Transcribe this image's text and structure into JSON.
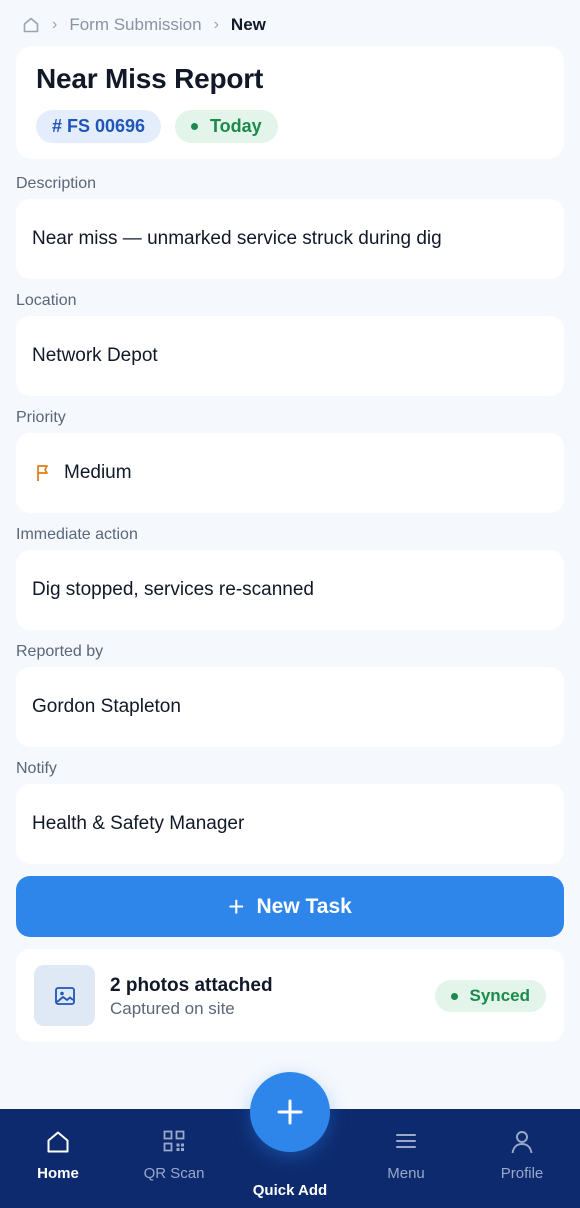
{
  "breadcrumb": {
    "home_icon": "home-icon",
    "parent": "Form Submission",
    "current": "New"
  },
  "header": {
    "title": "Near Miss Report",
    "id_badge": "# FS 00696",
    "date_badge": "Today"
  },
  "fields": {
    "description": {
      "label": "Description",
      "value": "Near miss — unmarked service struck during dig"
    },
    "location": {
      "label": "Location",
      "value": "Network Depot"
    },
    "priority": {
      "label": "Priority",
      "value": "Medium",
      "icon": "flag-icon",
      "color": "#e07b12"
    },
    "immediate_action": {
      "label": "Immediate action",
      "value": "Dig stopped, services re-scanned"
    },
    "reported_by": {
      "label": "Reported by",
      "value": "Gordon Stapleton"
    },
    "notify": {
      "label": "Notify",
      "value": "Health & Safety Manager"
    }
  },
  "new_task_button": {
    "label": "New Task"
  },
  "photos": {
    "title": "2 photos attached",
    "subtitle": "Captured on site",
    "status": "Synced"
  },
  "bottom_nav": {
    "items": [
      {
        "label": "Home",
        "icon": "home-icon",
        "active": true
      },
      {
        "label": "QR Scan",
        "icon": "qr-icon",
        "active": false
      },
      {
        "label": "Menu",
        "icon": "menu-icon",
        "active": false
      },
      {
        "label": "Profile",
        "icon": "profile-icon",
        "active": false
      }
    ],
    "fab_label": "Quick Add"
  },
  "colors": {
    "accent": "#2f86ea",
    "nav_background": "#0d2a6e",
    "success": "#1b8a4b",
    "id_badge_text": "#1f56b8"
  }
}
